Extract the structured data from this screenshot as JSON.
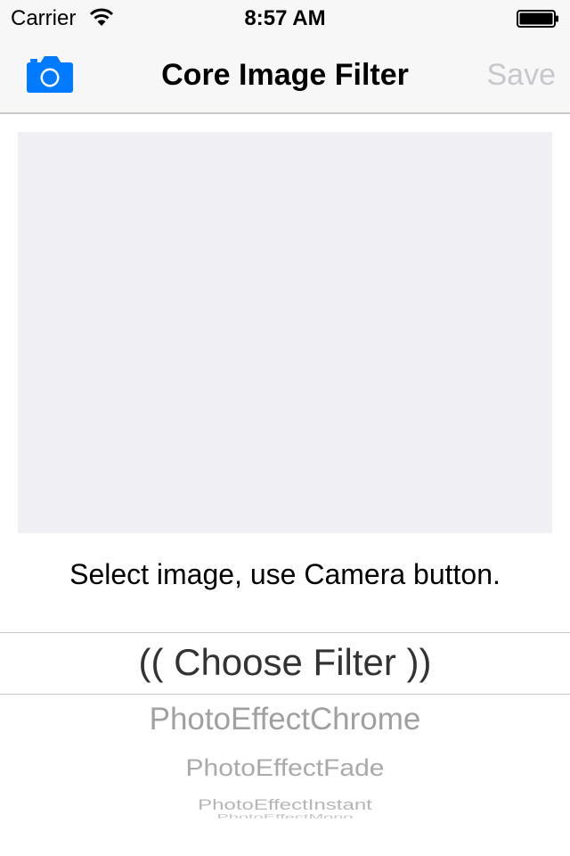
{
  "status_bar": {
    "carrier": "Carrier",
    "time": "8:57 AM",
    "wifi_icon": "wifi-icon",
    "battery_icon": "battery-icon"
  },
  "nav": {
    "title": "Core Image Filter",
    "camera_icon": "camera-icon",
    "save_label": "Save"
  },
  "main": {
    "hint": "Select image, use Camera button."
  },
  "picker": {
    "selected": "(( Choose Filter ))",
    "options": [
      "PhotoEffectChrome",
      "PhotoEffectFade",
      "PhotoEffectInstant",
      "PhotoEffectMono"
    ]
  },
  "colors": {
    "accent": "#007aff",
    "disabled": "#c7c7cc",
    "image_placeholder": "#efeff4"
  }
}
